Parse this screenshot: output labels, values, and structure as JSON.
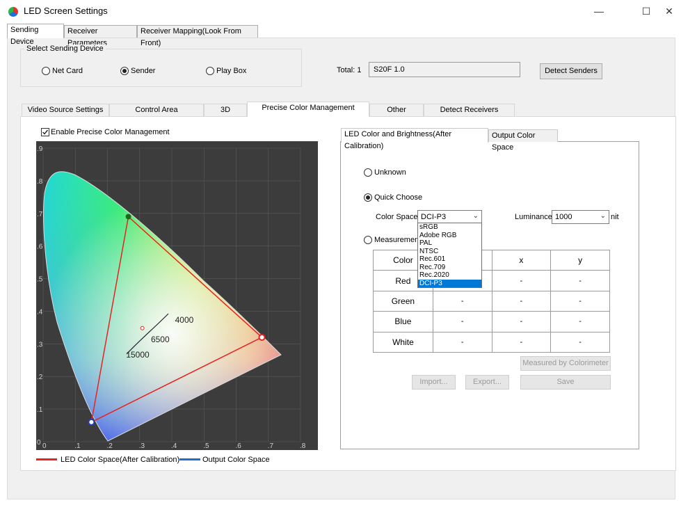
{
  "window": {
    "title": "LED Screen Settings",
    "minimize": "—",
    "maximize": "☐",
    "close": "✕"
  },
  "outer_tabs": [
    {
      "label": "Sending Device",
      "active": true
    },
    {
      "label": "Receiver Parameters",
      "active": false
    },
    {
      "label": "Receiver Mapping(Look From Front)",
      "active": false
    }
  ],
  "select_device": {
    "title": "Select Sending Device",
    "options": [
      {
        "label": "Net Card",
        "selected": false
      },
      {
        "label": "Sender",
        "selected": true
      },
      {
        "label": "Play Box",
        "selected": false
      }
    ],
    "total_label": "Total: 1",
    "sender_value": "S20F 1.0",
    "detect_button": "Detect Senders"
  },
  "inner_tabs": [
    {
      "label": "Video Source Settings",
      "active": false
    },
    {
      "label": "Control Area",
      "active": false
    },
    {
      "label": "3D",
      "active": false
    },
    {
      "label": "Precise Color Management",
      "active": true
    },
    {
      "label": "Other",
      "active": false
    },
    {
      "label": "Detect Receivers",
      "active": false
    }
  ],
  "enable_checkbox": {
    "label": "Enable Precise Color Management",
    "checked": true
  },
  "chart_data": {
    "type": "scatter",
    "title": "",
    "x_ticks": [
      "0",
      ".1",
      ".2",
      ".3",
      ".4",
      ".5",
      ".6",
      ".7",
      ".8"
    ],
    "y_ticks": [
      ".9",
      ".8",
      ".7",
      ".6",
      ".5",
      ".4",
      ".3",
      ".2",
      ".1",
      "0"
    ],
    "xlim": [
      0,
      0.8
    ],
    "ylim": [
      0,
      0.9
    ],
    "grid": true,
    "led_triangle": [
      [
        0.68,
        0.32
      ],
      [
        0.265,
        0.69
      ],
      [
        0.15,
        0.06
      ]
    ],
    "white_point": [
      0.3127,
      0.329
    ],
    "planckian_labels": [
      {
        "text": "4000",
        "x": 0.38,
        "y": 0.38
      },
      {
        "text": "6500",
        "x": 0.313,
        "y": 0.329
      },
      {
        "text": "15000",
        "x": 0.264,
        "y": 0.267
      }
    ],
    "legend": [
      {
        "name": "LED Color Space(After Calibration)",
        "color": "#e8231f"
      },
      {
        "name": "Output Color Space",
        "color": "#1f6fcf"
      }
    ]
  },
  "right_tabs": [
    {
      "label": "LED Color and Brightness(After Calibration)",
      "active": true
    },
    {
      "label": "Output Color Space",
      "active": false
    }
  ],
  "led_mode": {
    "unknown": {
      "label": "Unknown",
      "selected": false
    },
    "quick": {
      "label": "Quick Choose",
      "selected": true
    },
    "measurement": {
      "label": "Measurement",
      "selected": false
    }
  },
  "color_space": {
    "label": "Color Space",
    "value": "DCI-P3",
    "options": [
      "sRGB",
      "Adobe RGB",
      "PAL",
      "NTSC",
      "Rec.601",
      "Rec.709",
      "Rec.2020",
      "DCI-P3"
    ]
  },
  "luminance": {
    "label": "Luminance",
    "value": "1000",
    "unit": "nit"
  },
  "table": {
    "headers": [
      "Color",
      "",
      "x",
      "y"
    ],
    "rows": [
      {
        "color": "Red",
        "cells": [
          "-",
          "-",
          "-"
        ]
      },
      {
        "color": "Green",
        "cells": [
          "-",
          "-",
          "-"
        ]
      },
      {
        "color": "Blue",
        "cells": [
          "-",
          "-",
          "-"
        ]
      },
      {
        "color": "White",
        "cells": [
          "-",
          "-",
          "-"
        ]
      }
    ]
  },
  "buttons": {
    "measured": "Measured by Colorimeter",
    "import": "Import...",
    "export": "Export...",
    "save": "Save"
  }
}
